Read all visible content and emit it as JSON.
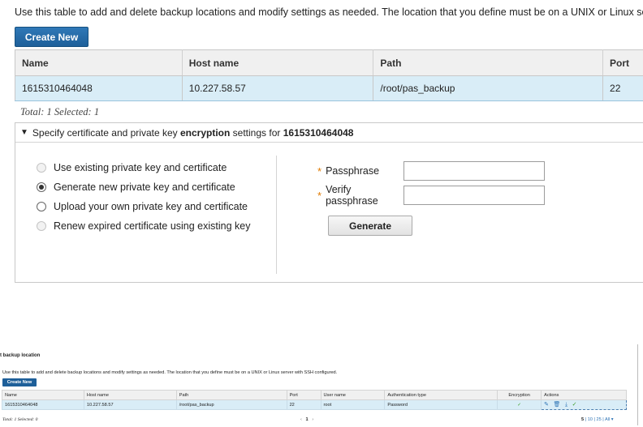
{
  "zoom": {
    "intro": "Use this table to add and delete backup locations and modify settings as needed. The location that you define must be on a UNIX or Linux server with SSH configured.",
    "create_new": "Create New",
    "columns": [
      "Name",
      "Host name",
      "Path",
      "Port"
    ],
    "row": [
      "1615310464048",
      "10.227.58.57",
      "/root/pas_backup",
      "22"
    ],
    "totals": "Total: 1 Selected: 1",
    "encryption": {
      "heading_prefix": "Specify certificate and private key ",
      "heading_bold": "encryption",
      "heading_middle": " settings for ",
      "heading_name": "1615310464048",
      "options": [
        "Use existing private key and certificate",
        "Generate new private key and certificate",
        "Upload your own private key and certificate",
        "Renew expired certificate using existing key"
      ],
      "selected_option": 1,
      "passphrase_label": "Passphrase",
      "verify_label": "Verify passphrase",
      "passphrase_value": "",
      "verify_value": "",
      "generate": "Generate"
    }
  },
  "mini": {
    "title": "t backup location",
    "intro": "Use this table to add and delete backup locations and modify settings as needed. The location that you define must be on a UNIX or Linux server with SSH configured.",
    "create_new": "Create New",
    "columns": [
      "Name",
      "Host name",
      "Path",
      "Port",
      "User name",
      "Authentication type",
      "Encryption",
      "Actions"
    ],
    "row": [
      "1615310464048",
      "10.227.58.57",
      "/root/pas_backup",
      "22",
      "root",
      "Password",
      "✓",
      ""
    ],
    "totals": "Total: 1 Selected: 0",
    "pager_prev": "‹",
    "pager_page": "1",
    "pager_next": "›",
    "page_sizes": [
      "5",
      "10",
      "25",
      "All"
    ],
    "active_page_size": "5",
    "page_size_arrow": "▾"
  },
  "icons": [
    "edit-icon",
    "trash-icon",
    "download-icon",
    "check-icon",
    "triangle-down-icon"
  ],
  "colors": {
    "primary": "#1e5f99",
    "selected_row": "#d9edf7",
    "required": "#e07a00",
    "success": "#3a9d23"
  }
}
